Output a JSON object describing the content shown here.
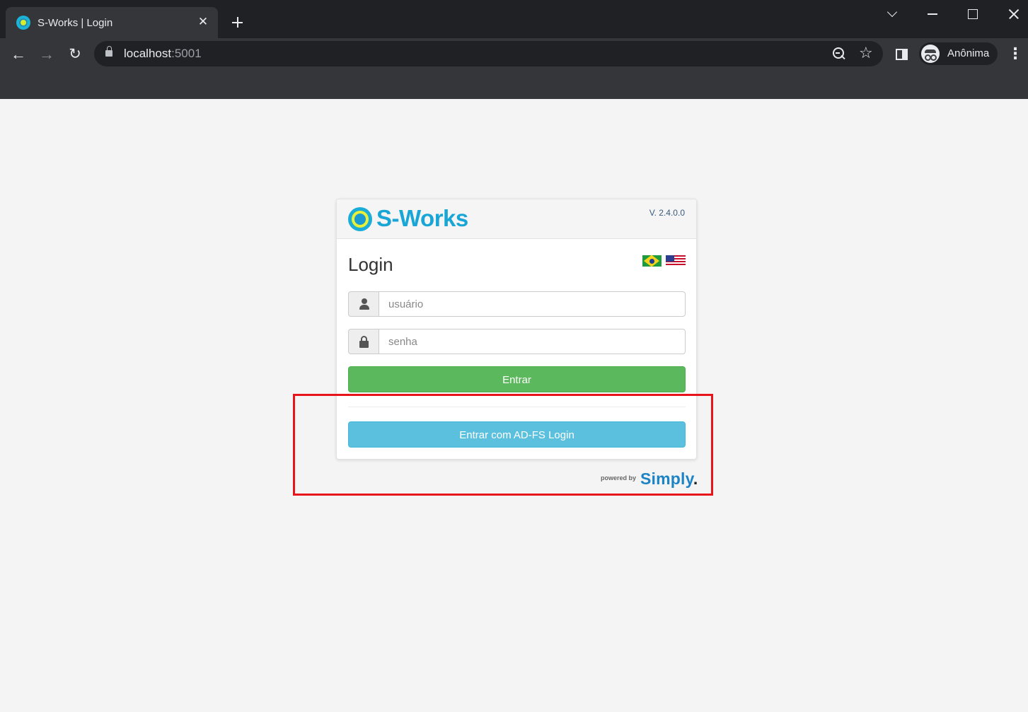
{
  "browser": {
    "tab_title": "S-Works | Login",
    "tab_close_glyph": "✕",
    "url_host": "localhost",
    "url_port": ":5001",
    "profile_label": "Anônima",
    "back_glyph": "←",
    "forward_glyph": "→",
    "reload_glyph": "↻",
    "star_glyph": "☆",
    "menu_glyph": "⋮",
    "icons": [
      "favicon-sworks",
      "new-tab-icon",
      "chevron-down-icon",
      "minimize-icon",
      "maximize-icon",
      "close-icon",
      "lock-icon",
      "zoom-out-icon",
      "star-icon",
      "side-panel-icon",
      "incognito-icon",
      "kebab-menu-icon"
    ]
  },
  "login": {
    "brand": "S-Works",
    "version": "V. 2.4.0.0",
    "title": "Login",
    "languages": [
      "pt-BR",
      "en-US"
    ],
    "username_placeholder": "usuário",
    "password_placeholder": "senha",
    "submit_label": "Entrar",
    "adfs_label": "Entrar com AD-FS Login",
    "powered_by": "powered by",
    "vendor": "Simply",
    "vendor_dot": "."
  },
  "colors": {
    "primary_green": "#5cb85c",
    "info_blue": "#5bc0de",
    "brand_blue": "#19a6d6",
    "annotation_red": "#e8141b"
  }
}
